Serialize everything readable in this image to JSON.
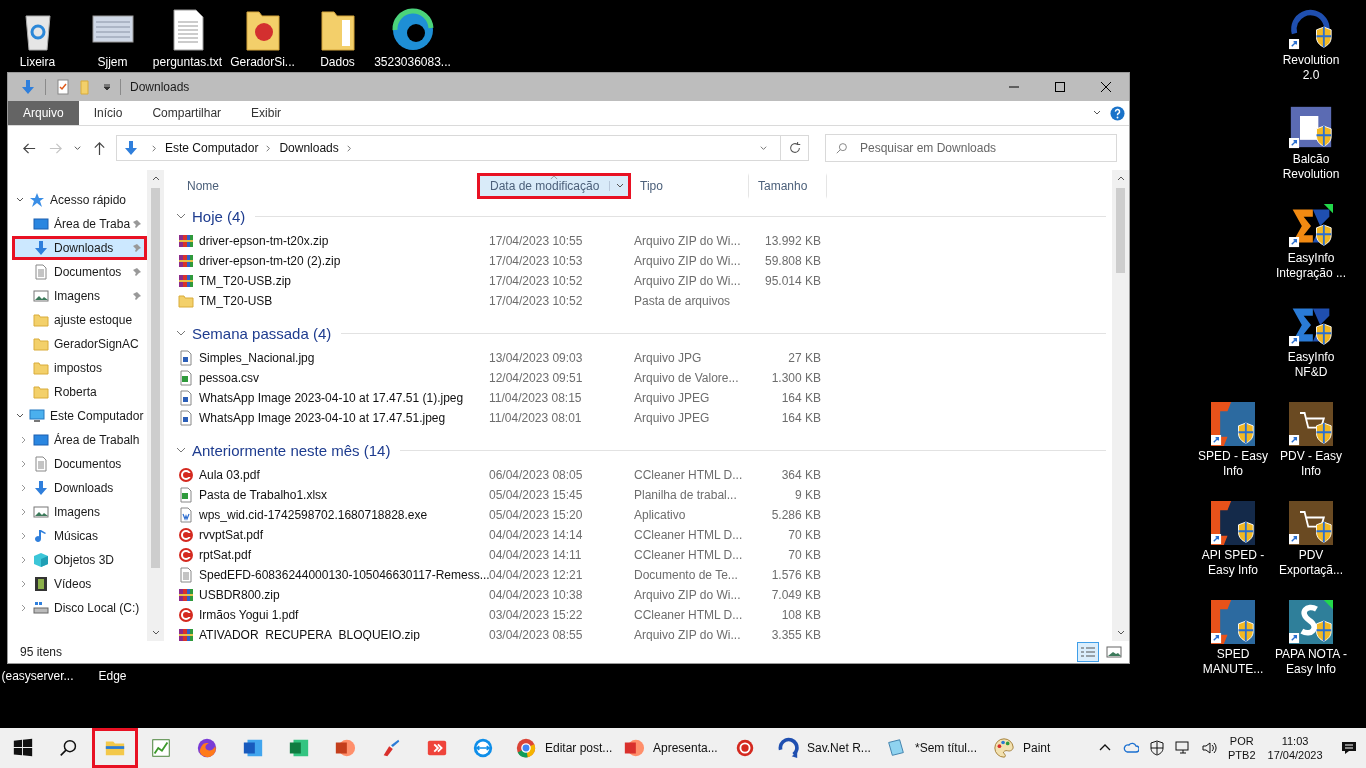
{
  "desktop_icons": [
    {
      "label": "Lixeira",
      "kind": "recycle-bin"
    },
    {
      "label": "Sjjem",
      "kind": "screenshot"
    },
    {
      "label": "perguntas.txt",
      "kind": "text-file"
    },
    {
      "label": "GeradorSi...",
      "kind": "app-folder"
    },
    {
      "label": "Dados",
      "kind": "folder"
    },
    {
      "label": "3523036083...",
      "kind": "swirl"
    }
  ],
  "desktop_hidden_labels": [
    "(easyserver...",
    "Edge"
  ],
  "desktop_side_icons": [
    {
      "label": "Revolution 2.0",
      "kind": "revolution"
    },
    {
      "label": "Balcão Revolution",
      "kind": "clipboard"
    },
    {
      "label": "EasyInfo Integração ...",
      "kind": "sigma-orange"
    },
    {
      "label": "EasyInfo NF&D",
      "kind": "sigma-blue"
    },
    {
      "label": "SPED - Easy Info",
      "kind": "sped"
    },
    {
      "label": "PDV - Easy Info",
      "kind": "cart"
    },
    {
      "label": "API SPED - Easy Info",
      "kind": "sped-dark"
    },
    {
      "label": "PDV Exportaçã...",
      "kind": "cart"
    },
    {
      "label": "SPED MANUTE...",
      "kind": "sped"
    },
    {
      "label": "PAPA NOTA - Easy Info",
      "kind": "letter"
    }
  ],
  "window": {
    "title": "Downloads",
    "ribbon_tabs": [
      {
        "label": "Arquivo",
        "selected": true
      },
      {
        "label": "Início",
        "selected": false
      },
      {
        "label": "Compartilhar",
        "selected": false
      },
      {
        "label": "Exibir",
        "selected": false
      }
    ],
    "nav_buttons": [
      {
        "kind": "back",
        "disabled": false
      },
      {
        "kind": "forward",
        "disabled": true
      },
      {
        "kind": "recent",
        "disabled": false
      },
      {
        "kind": "up",
        "disabled": false
      }
    ],
    "address": [
      "Este Computador",
      "Downloads"
    ],
    "search": {
      "placeholder": "Pesquisar em Downloads"
    },
    "sidebar": [
      {
        "label": "Acesso rápido",
        "kind": "quick",
        "expanded": true,
        "selected": false,
        "highlighted": false,
        "children": [
          {
            "label": "Área de Traba",
            "kind": "desktop",
            "pinned": true,
            "selected": false,
            "highlighted": false
          },
          {
            "label": "Downloads",
            "kind": "downloads",
            "pinned": true,
            "selected": true,
            "highlighted": true
          },
          {
            "label": "Documentos",
            "kind": "documents",
            "pinned": true,
            "selected": false,
            "highlighted": false
          },
          {
            "label": "Imagens",
            "kind": "images",
            "pinned": true,
            "selected": false,
            "highlighted": false
          },
          {
            "label": "ajuste estoque",
            "kind": "folder",
            "pinned": false,
            "selected": false,
            "highlighted": false
          },
          {
            "label": "GeradorSignAC",
            "kind": "folder",
            "pinned": false,
            "selected": false,
            "highlighted": false
          },
          {
            "label": "impostos",
            "kind": "folder",
            "pinned": false,
            "selected": false,
            "highlighted": false
          },
          {
            "label": "Roberta",
            "kind": "folder",
            "pinned": false,
            "selected": false,
            "highlighted": false
          }
        ]
      },
      {
        "label": "Este Computador",
        "kind": "computer",
        "expanded": true,
        "selected": false,
        "highlighted": false,
        "children": [
          {
            "label": "Área de Trabalh",
            "kind": "desktop",
            "expanded": false,
            "selected": false,
            "highlighted": false
          },
          {
            "label": "Documentos",
            "kind": "documents",
            "expanded": false,
            "selected": false,
            "highlighted": false
          },
          {
            "label": "Downloads",
            "kind": "downloads",
            "expanded": false,
            "selected": false,
            "highlighted": false
          },
          {
            "label": "Imagens",
            "kind": "images",
            "expanded": false,
            "selected": false,
            "highlighted": false
          },
          {
            "label": "Músicas",
            "kind": "music",
            "expanded": false,
            "selected": false,
            "highlighted": false
          },
          {
            "label": "Objetos 3D",
            "kind": "cube",
            "expanded": false,
            "selected": false,
            "highlighted": false
          },
          {
            "label": "Vídeos",
            "kind": "video",
            "expanded": false,
            "selected": false,
            "highlighted": false
          },
          {
            "label": "Disco Local (C:)",
            "kind": "drive",
            "expanded": false,
            "selected": false,
            "highlighted": false
          }
        ]
      }
    ],
    "columns": [
      {
        "label": "Nome",
        "sorted": false,
        "highlighted": false
      },
      {
        "label": "Data de modificação",
        "sorted": true,
        "highlighted": true
      },
      {
        "label": "Tipo",
        "sorted": false,
        "highlighted": false
      },
      {
        "label": "Tamanho",
        "sorted": false,
        "highlighted": false
      }
    ],
    "groups": [
      {
        "label": "Hoje (4)",
        "expanded": true,
        "rows": [
          {
            "name": "driver-epson-tm-t20x.zip",
            "kind": "zip",
            "date": "17/04/2023 10:55",
            "type": "Arquivo ZIP do Wi...",
            "size": "13.992 KB"
          },
          {
            "name": "driver-epson-tm-t20 (2).zip",
            "kind": "zip",
            "date": "17/04/2023 10:53",
            "type": "Arquivo ZIP do Wi...",
            "size": "59.808 KB"
          },
          {
            "name": "TM_T20-USB.zip",
            "kind": "zip",
            "date": "17/04/2023 10:52",
            "type": "Arquivo ZIP do Wi...",
            "size": "95.014 KB"
          },
          {
            "name": "TM_T20-USB",
            "kind": "folder",
            "date": "17/04/2023 10:52",
            "type": "Pasta de arquivos"
          }
        ]
      },
      {
        "label": "Semana passada (4)",
        "expanded": true,
        "rows": [
          {
            "name": "Simples_Nacional.jpg",
            "kind": "image",
            "date": "13/04/2023 09:03",
            "type": "Arquivo JPG",
            "size": "27 KB"
          },
          {
            "name": "pessoa.csv",
            "kind": "csv",
            "date": "12/04/2023 09:51",
            "type": "Arquivo de Valore...",
            "size": "1.300 KB"
          },
          {
            "name": "WhatsApp Image 2023-04-10 at 17.47.51 (1).jpeg",
            "kind": "image",
            "date": "11/04/2023 08:15",
            "type": "Arquivo JPEG",
            "size": "164 KB"
          },
          {
            "name": "WhatsApp Image 2023-04-10 at 17.47.51.jpeg",
            "kind": "image",
            "date": "11/04/2023 08:01",
            "type": "Arquivo JPEG",
            "size": "164 KB"
          }
        ]
      },
      {
        "label": "Anteriormente neste mês (14)",
        "expanded": true,
        "rows": [
          {
            "name": "Aula 03.pdf",
            "kind": "pdf",
            "date": "06/04/2023 08:05",
            "type": "CCleaner HTML D...",
            "size": "364 KB"
          },
          {
            "name": "Pasta de Trabalho1.xlsx",
            "kind": "xlsx",
            "date": "05/04/2023 15:45",
            "type": "Planilha de trabal...",
            "size": "9 KB"
          },
          {
            "name": "wps_wid.cid-1742598702.1680718828.exe",
            "kind": "exe",
            "date": "05/04/2023 15:20",
            "type": "Aplicativo",
            "size": "5.286 KB"
          },
          {
            "name": "rvvptSat.pdf",
            "kind": "pdf",
            "date": "04/04/2023 14:14",
            "type": "CCleaner HTML D...",
            "size": "70 KB"
          },
          {
            "name": "rptSat.pdf",
            "kind": "pdf",
            "date": "04/04/2023 14:11",
            "type": "CCleaner HTML D...",
            "size": "70 KB"
          },
          {
            "name": "SpedEFD-60836244000130-105046630117-Remess...",
            "kind": "txt",
            "date": "04/04/2023 12:21",
            "type": "Documento de Te...",
            "size": "1.576 KB"
          },
          {
            "name": "USBDR800.zip",
            "kind": "zip",
            "date": "04/04/2023 10:38",
            "type": "Arquivo ZIP do Wi...",
            "size": "7.049 KB"
          },
          {
            "name": "Irmãos Yogui 1.pdf",
            "kind": "pdf",
            "date": "03/04/2023 15:22",
            "type": "CCleaner HTML D...",
            "size": "108 KB"
          },
          {
            "name": "ATIVADOR_RECUPERA_BLOQUEIO.zip",
            "kind": "zip",
            "date": "03/04/2023 08:55",
            "type": "Arquivo ZIP do Wi...",
            "size": "3.355 KB"
          }
        ]
      }
    ],
    "status_bar": {
      "item_count": "95 itens"
    },
    "view_buttons": [
      {
        "kind": "details",
        "selected": true
      },
      {
        "kind": "large-icons",
        "selected": false
      }
    ]
  },
  "taskbar": {
    "items": [
      {
        "kind": "start",
        "highlighted": false
      },
      {
        "kind": "search",
        "highlighted": false
      },
      {
        "kind": "explorer",
        "highlighted": true
      },
      {
        "kind": "chart",
        "highlighted": false
      },
      {
        "kind": "fox",
        "highlighted": false
      },
      {
        "kind": "word",
        "highlighted": false
      },
      {
        "kind": "excel",
        "highlighted": false
      },
      {
        "kind": "ppt",
        "highlighted": false
      },
      {
        "kind": "brush",
        "highlighted": false
      },
      {
        "kind": "remote",
        "highlighted": false
      },
      {
        "kind": "remote-control",
        "highlighted": false
      },
      {
        "kind": "chrome",
        "label": "Editar post...",
        "highlighted": false
      },
      {
        "kind": "wps",
        "label": "Apresenta...",
        "highlighted": false
      },
      {
        "kind": "circle-logo",
        "highlighted": false
      },
      {
        "kind": "swirl",
        "label": "Sav.Net R...",
        "highlighted": false
      },
      {
        "kind": "notepad",
        "label": "*Sem títul...",
        "highlighted": false
      },
      {
        "kind": "paint",
        "label": "Paint",
        "highlighted": false
      }
    ],
    "tray_icons": [
      {
        "kind": "chevron"
      },
      {
        "kind": "cloud"
      },
      {
        "kind": "shield"
      },
      {
        "kind": "network"
      },
      {
        "kind": "volume"
      }
    ],
    "language": [
      "POR",
      "PTB2"
    ],
    "time": "11:03",
    "date": "17/04/2023"
  }
}
